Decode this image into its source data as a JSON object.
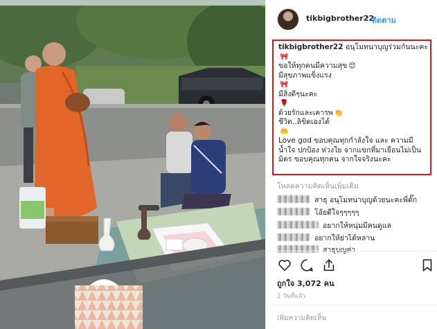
{
  "post": {
    "username": "tikbigbrother22",
    "separator": "•",
    "follow_label": "ติดตาม"
  },
  "caption": {
    "username": "tikbigbrother22",
    "lines": [
      "อนุโมทนาบุญร่วมกันนะคะ",
      "ขอให้ทุกคนมีความสุข",
      "มีสุขภาพแข็งแรง",
      "มีสิ่งดีๆนะคะ",
      "ด้วยรักและเคารพ",
      "ชีวิต..ลิขิตเองได้",
      "Love god ขอบคุณทุกกำลังใจ และ ความมี",
      "น้ำใจ ปกป้อง ห่วงใย จากแขกที่มาเยือนไม่เป็น",
      "มิตร ขอบคุณทุกคน จากใจจริงนะคะ"
    ],
    "emojis": [
      "ribbon",
      "smile-face",
      "ribbon",
      "ribbon",
      "rose",
      "clap-hand",
      "blue-hand"
    ]
  },
  "comments": {
    "load_more": "โหลดความคิดเห็นเพิ่มเติม",
    "items": [
      {
        "text": "สาธุ อนุโมทนาบุญด้วยนะคะพี่ตั๊ก"
      },
      {
        "text": "โอ้ยดีใจๆๆๆๆๆ"
      },
      {
        "text": "อยากให้หนุ่มมีคนดูแล"
      },
      {
        "text": "อยากให้ย่าได้หลาน"
      },
      {
        "text": "สาธุบญค่า"
      }
    ]
  },
  "actions": {
    "likes_label": "ถูกใจ 3,072 คน",
    "time_ago": "1 วันที่แล้ว",
    "add_comment_placeholder": "เพิ่มความคิดเห็น"
  },
  "colors": {
    "highlight_border": "#e0111a",
    "follow_blue": "#3897f0",
    "monk_robe": "#e2662a"
  }
}
